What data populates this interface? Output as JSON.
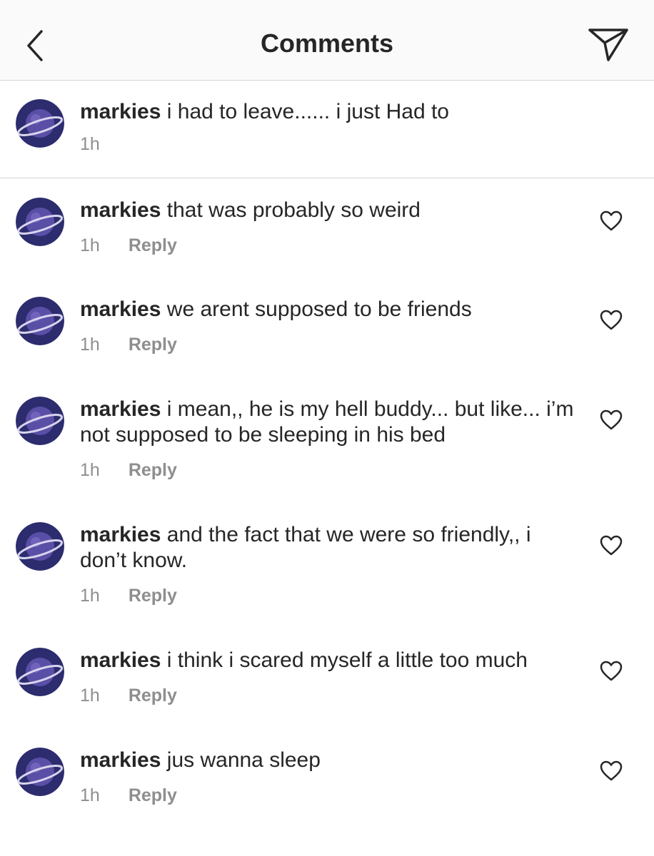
{
  "header": {
    "title": "Comments",
    "back_icon": "chevron-left-icon",
    "send_icon": "paper-plane-icon"
  },
  "caption": {
    "username": "markies",
    "text": "i had to leave...... i just Had to",
    "time": "1h"
  },
  "comments": [
    {
      "username": "markies",
      "text": "that was probably so weird",
      "time": "1h",
      "reply": "Reply"
    },
    {
      "username": "markies",
      "text": "we arent supposed to be friends",
      "time": "1h",
      "reply": "Reply"
    },
    {
      "username": "markies",
      "text": "i mean,, he is my hell buddy... but like... i’m not supposed to be sleeping in his bed",
      "time": "1h",
      "reply": "Reply"
    },
    {
      "username": "markies",
      "text": "and the fact that we were so friendly,, i don’t know.",
      "time": "1h",
      "reply": "Reply"
    },
    {
      "username": "markies",
      "text": "i think i scared myself a little too much",
      "time": "1h",
      "reply": "Reply"
    },
    {
      "username": "markies",
      "text": "jus wanna sleep",
      "time": "1h",
      "reply": "Reply"
    }
  ],
  "colors": {
    "text": "#262626",
    "muted": "#8e8e8e",
    "header_bg": "#fafafa",
    "divider": "#d4d4d4",
    "avatar_bg": "#2c2c6e"
  }
}
